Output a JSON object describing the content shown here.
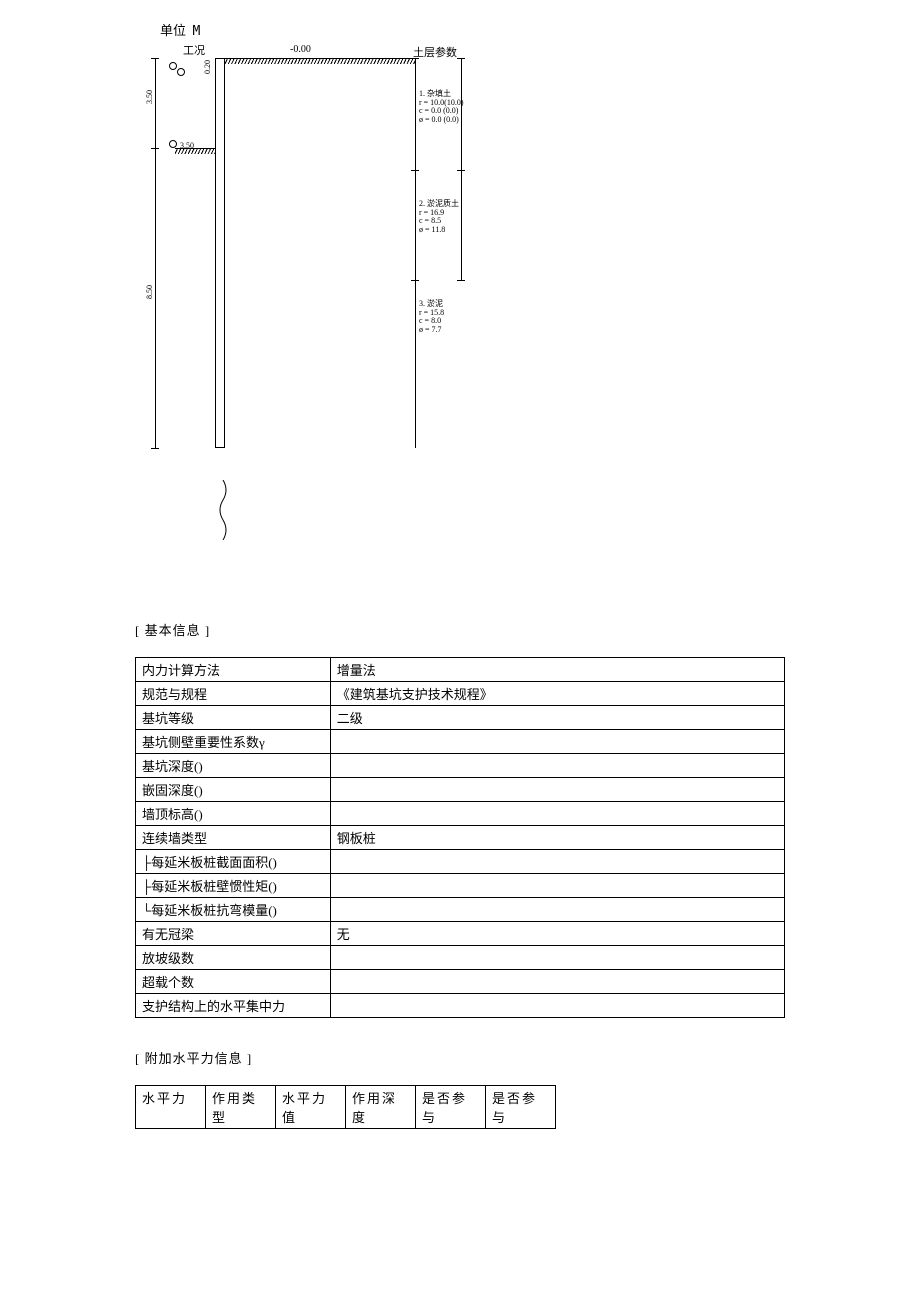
{
  "diagram": {
    "unit_label": "单位",
    "unit_value": "M",
    "condition_label": "工况",
    "ground_level": "-0.00",
    "dim1": "3.50",
    "dim1_mark": "3.50",
    "dim2": "8.50",
    "small_dim": "0.20",
    "soil_params_label": "土层参数",
    "layer1": {
      "name": "1. 杂填土",
      "r": "r  =  10.0(10.0)",
      "c": "c  =  0.0  (0.0)",
      "phi": "ø  =  0.0  (0.0)"
    },
    "layer2": {
      "name": "2. 淤泥质土",
      "r": "r  =  16.9",
      "c": "c  =  8.5",
      "phi": "ø  =  11.8"
    },
    "layer3": {
      "name": "3. 淤泥",
      "r": "r  =  15.8",
      "c": "c  =  8.0",
      "phi": "ø  =  7.7"
    }
  },
  "sections": {
    "basic": "[ 基本信息 ]",
    "horizontal": "[ 附加水平力信息 ]"
  },
  "basic_info": {
    "rows": [
      {
        "label": "内力计算方法",
        "value": "增量法"
      },
      {
        "label": "规范与规程",
        "value": "《建筑基坑支护技术规程》"
      },
      {
        "label": "基坑等级",
        "value": "二级"
      },
      {
        "label": "基坑侧壁重要性系数γ",
        "value": ""
      },
      {
        "label": "基坑深度()",
        "value": ""
      },
      {
        "label": "嵌固深度()",
        "value": ""
      },
      {
        "label": "墙顶标高()",
        "value": ""
      },
      {
        "label": "连续墙类型",
        "value": "钢板桩"
      },
      {
        "label": "├每延米板桩截面面积()",
        "value": ""
      },
      {
        "label": "├每延米板桩壁惯性矩()",
        "value": ""
      },
      {
        "label": "└每延米板桩抗弯模量()",
        "value": ""
      },
      {
        "label": "有无冠梁",
        "value": "无"
      },
      {
        "label": "放坡级数",
        "value": ""
      },
      {
        "label": "超载个数",
        "value": ""
      },
      {
        "label": "支护结构上的水平集中力",
        "value": ""
      }
    ]
  },
  "horizontal_force": {
    "headers": [
      "水平力",
      "作用类型",
      "水平力值",
      "作用深度",
      "是否参与",
      "是否参与"
    ]
  }
}
